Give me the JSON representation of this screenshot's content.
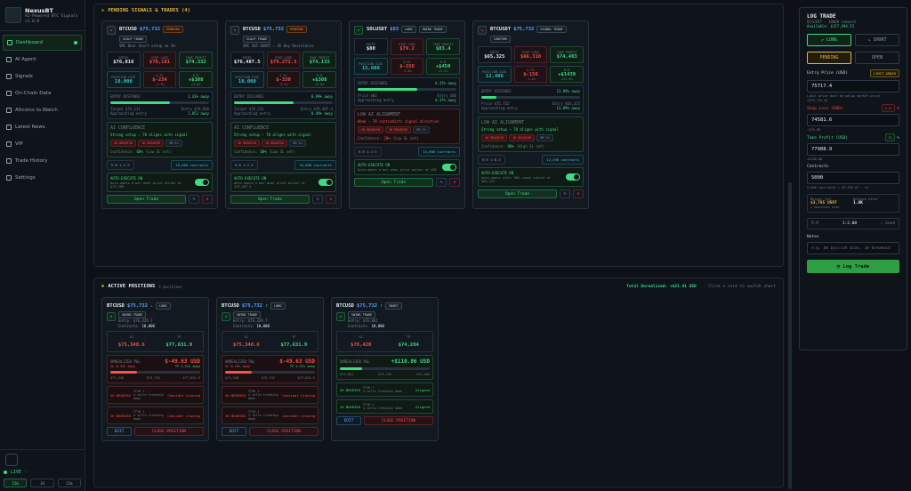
{
  "sidebar": {
    "brand": "NexusBT",
    "tagline": "AI-Powered BTC Signals",
    "version": "v1.0.0",
    "items": [
      {
        "label": "Dashboard",
        "active": true
      },
      {
        "label": "AI Agent"
      },
      {
        "label": "Signals"
      },
      {
        "label": "On-Chain Data"
      },
      {
        "label": "Altcoins to Watch"
      },
      {
        "label": "Latest News"
      },
      {
        "label": "VIP"
      },
      {
        "label": "Trade History"
      },
      {
        "label": "Settings"
      }
    ],
    "live": "LIVE",
    "timeframes": [
      "15m",
      "1H",
      "15m"
    ]
  },
  "pending": {
    "title": "PENDING SIGNALS & TRADES (4)",
    "cards": [
      {
        "symbol": "BTCUSD",
        "price": "$75,732",
        "dir": "down",
        "tags": [
          "PENDING",
          "SCALP TRADE"
        ],
        "desc": "SMC Bear Short setup on 1H",
        "entry_l": "ENTRY",
        "entry": "$76,816",
        "sl_l": "STOP LOSS",
        "sl": "$78,181",
        "tp_l": "TAKE PROFIT",
        "tp": "$74,332",
        "pos_l": "POSITION SIZE",
        "pos": "10,000",
        "pct_l": "$ PL",
        "pct": "$-234",
        "pct_s": "-2.3%",
        "rr_l": "R:R",
        "rr": "+$308",
        "rr_s": "+3.0%",
        "dist_l": "ENTRY DISTANCE",
        "dist": "1.43% away",
        "target": "Target $76,211",
        "entryv": "Entry $76,816",
        "approach": "Approaching entry",
        "approach_v": "1,053 away",
        "confl": "AI CONFLUENCE",
        "strong": "Strong setup — 78 aligns with signal",
        "chips": [
          "4H BEARISH",
          "1H BEARISH",
          "5M 1%"
        ],
        "conf_l": "Confidence:",
        "conf": "68%",
        "conf_s": "(Low SL set)",
        "rrv": "R:R 1:2.9",
        "contracts": "10,000 contracts",
        "auto": "AUTO-EXECUTE ON",
        "auto_desc": "Auto-opens a bar when price action at $75,280",
        "open": "Open Trade"
      },
      {
        "symbol": "BTCUSD",
        "price": "$75,732",
        "dir": "down",
        "tags": [
          "PENDING",
          "SCALP TRADE"
        ],
        "desc": "SMC 1H5 SHORT — 4h Key Resistance",
        "entry_l": "ENTRY",
        "entry": "$76,487.5",
        "sl_l": "STOP LOSS",
        "sl": "$79,272.3",
        "tp_l": "TAKE PROFIT",
        "tp": "$74,133",
        "pos_l": "POSITION SIZE",
        "pos": "10,000",
        "pct_l": "$ PL",
        "pct": "$-330",
        "pct_s": "-3.3%",
        "rr_l": "R:R",
        "rr": "+$308",
        "rr_s": "+3.0%",
        "dist_l": "ENTRY DISTANCE",
        "dist": "0.99% away",
        "target": "Target $76,211",
        "entryv": "Entry $76,487.4",
        "approach": "Approaching entry",
        "approach_v": "0.49% away",
        "confl": "AI CONFLUENCE",
        "strong": "Strong setup — 78 aligns with signal",
        "chips": [
          "4H BEARISH",
          "1H BEARISH",
          "5M 1%"
        ],
        "conf_l": "Confidence:",
        "conf": "68%",
        "conf_s": "(Low SL set)",
        "rrv": "R:R 1:2.9",
        "contracts": "10,000 contracts",
        "auto": "AUTO-EXECUTE ON",
        "auto_desc": "Auto-opens a bar when price action at $76,487.4",
        "open": "Open Trade"
      },
      {
        "symbol": "SOLUSDT",
        "price": "$83",
        "dir": "up",
        "tags": [
          "LONG",
          "SWING TRADE"
        ],
        "desc": "",
        "entry_l": "ENTRY",
        "entry": "$80",
        "sl_l": "STOP LOSS",
        "sl": "$79.2",
        "tp_l": "TAKE PROFIT",
        "tp": "$83.4",
        "pos_l": "POSITION SIZE",
        "pos": "15,606",
        "pct_l": "$ PL",
        "pct": "$-156",
        "pct_s": "-1.0%",
        "rr_l": "R:R",
        "rr": "+$450",
        "rr_s": "+2.9%",
        "dist_l": "ENTRY DISTANCE",
        "dist": "4.37% away",
        "target": "Price $83",
        "entryv": "Entry $80",
        "approach": "Approaching entry",
        "approach_v": "4.37% away",
        "confl": "LOW AI ALIGNMENT",
        "strong": "Weak — 78 contradicts signal direction",
        "chips": [
          "4H BEARISH",
          "1H BEARISH",
          "5M 1%"
        ],
        "conf_l": "Confidence:",
        "conf": "20%",
        "conf_s": "(Low SL set)",
        "rrv": "R:R 1:2.9",
        "contracts": "15,606 contracts",
        "auto": "AUTO-EXECUTE ON",
        "auto_desc": "Auto-opens a bar when price action at $80",
        "open": "Open Trade"
      },
      {
        "symbol": "BTCUSDT",
        "price": "$75,732",
        "dir": "down",
        "tags": [
          "SIGNAL TRADE",
          "CONFIRM"
        ],
        "desc": "",
        "entry_l": "ENTRY",
        "entry": "$65,325",
        "sl_l": "STOP LOSS",
        "sl": "$66,310",
        "tp_l": "TAKE PROFIT",
        "tp": "$74,403",
        "pos_l": "POSITION SIZE",
        "pos": "12,496",
        "pct_l": "$ PL",
        "pct": "$-156",
        "pct_s": "-1.2%",
        "rr_l": "R:R",
        "rr": "+$1439",
        "rr_s": "+11.5%",
        "dist_l": "ENTRY DISTANCE",
        "dist": "13.89% away",
        "target": "Price $75,732",
        "entryv": "Entry $65,325",
        "approach": "Approaching entry",
        "approach_v": "13.89% away",
        "confl": "LOW AI ALIGNMENT",
        "strong": "Strong setup — 78 aligns with signal",
        "chips": [
          "4H BEARISH",
          "1H BEARISH",
          "5M 1%"
        ],
        "conf_l": "Confidence:",
        "conf": "88%",
        "conf_s": "(High SL set)",
        "rrv": "R:R 1:8.3",
        "contracts": "12,496 contracts",
        "auto": "AUTO-EXECUTE ON",
        "auto_desc": "Auto-opens after 80% cause notice at $65,325",
        "open": "Open Trade"
      }
    ]
  },
  "active": {
    "title": "ACTIVE POSITIONS",
    "count": "3 positions",
    "total_label": "Total Unrealized:",
    "total": "+$21.41 USD",
    "hint": "· Click a card to switch chart",
    "cards": [
      {
        "symbol": "BTCUSD",
        "price": "$75,732",
        "dir": "down",
        "side": "LONG",
        "type": "SWING TRADE",
        "entry": "Entry: $76,329.7",
        "contracts_l": "Contracts:",
        "contracts": "10,000",
        "sl_l": "SL",
        "sl": "$75,348.6",
        "tp_l": "TP",
        "tp": "$77,631.9",
        "pnl_l": "UNREALIZED P&L",
        "pnl": "$-49.63 USD",
        "pnl_color": "red",
        "left": "SL 0.43% away",
        "right": "TP 2.51% away",
        "lv1": "$75,348",
        "lv2": "$75,732",
        "lv3": "$77,631.9",
        "sigs": [
          {
            "tag": "4H BEARISH",
            "tf": "TF4H 1",
            "txt": "4 inflo trending down",
            "act": "Consider closing",
            "g": false
          },
          {
            "tag": "1H BEARISH",
            "tf": "TF1H 1",
            "txt": "4 inflo trending down",
            "act": "Consider closing",
            "g": false
          }
        ],
        "edit": "EDIT",
        "close": "CLOSE POSITION"
      },
      {
        "symbol": "BTCUSD",
        "price": "$75,732",
        "dir": "up",
        "side": "LONG",
        "type": "SWING TRADE",
        "entry": "Entry: $76,329.7",
        "contracts_l": "Contracts:",
        "contracts": "10,000",
        "sl_l": "SL",
        "sl": "$75,348.6",
        "tp_l": "TP",
        "tp": "$77,631.9",
        "pnl_l": "UNREALIZED P&L",
        "pnl": "$-49.63 USD",
        "pnl_color": "red",
        "left": "SL 0.43% away",
        "right": "TP 2.51% away",
        "lv1": "$75,348",
        "lv2": "$75,732",
        "lv3": "$77,631.9",
        "sigs": [
          {
            "tag": "4H BEARISH",
            "tf": "TF4H 1",
            "txt": "4 inflo trending down",
            "act": "Consider closing",
            "g": false
          },
          {
            "tag": "1H BEARISH",
            "tf": "TF1H 1",
            "txt": "4 inflo trending down",
            "act": "Consider closing",
            "g": false
          }
        ],
        "edit": "EDIT",
        "close": "CLOSE POSITION"
      },
      {
        "symbol": "BTCUSD",
        "price": "$75,732",
        "dir": "up",
        "side": "SHORT",
        "type": "SWING TRADE",
        "entry": "Entry: $76,861",
        "contracts_l": "Contracts:",
        "contracts": "10,000",
        "sl_l": "SL",
        "sl": "$78,420",
        "tp_l": "TP",
        "tp": "$74,204",
        "pnl_l": "UNREALIZED P&L",
        "pnl": "+$110.86 USD",
        "pnl_color": "green",
        "left": "",
        "right": "",
        "lv1": "$75,861",
        "lv2": "$75,732",
        "lv3": "$74,406",
        "sigs": [
          {
            "tag": "4H BEARISH",
            "tf": "TF4H 1",
            "txt": "4 inflo trending down",
            "act": "Aligned",
            "g": true
          },
          {
            "tag": "1H BEARISH",
            "tf": "TF1H 1",
            "txt": "4 inflo trending down",
            "act": "Aligned",
            "g": true
          }
        ],
        "edit": "EDIT",
        "close": "CLOSE POSITION"
      }
    ]
  },
  "log": {
    "title": "LOG TRADE",
    "sub": "BTCUSDT · 10000 Lamaunt",
    "avail": "Available: $127,494.55",
    "long": "LONG",
    "short": "SHORT",
    "pending": "PENDING",
    "open": "OPEN",
    "entry_l": "Entry Price (USD)",
    "limit": "LIMIT ORDER",
    "entry": "75717.4",
    "entry_hint": "Limit price must be below market price ($75,732.0)",
    "sl_l": "Stop Loss (USD)",
    "sl_pct": "1.5",
    "sl": "74581.6",
    "sl_note": "-$75.09",
    "tp_l": "Take Profit (USD)",
    "tp_pct": "3",
    "tp": "77988.9",
    "tp_note": "+$150.00",
    "contracts_l": "Contracts",
    "contracts": "5000",
    "contracts_hint": "5,000 contracts = $3,785.87 · 1x",
    "margin_l": "Margin (1x)",
    "margin": "$3,785 USDT",
    "margin_s": "+ position size",
    "bal_l": "Balance After",
    "bal": "1.8K",
    "rr_l": "R:R",
    "rr": "1:2.00",
    "rr_r": "✓ Good",
    "notes_l": "Notes",
    "notes_ph": "e.g. 4H bullish bias, 1H breakout",
    "submit": "Log Trade"
  }
}
